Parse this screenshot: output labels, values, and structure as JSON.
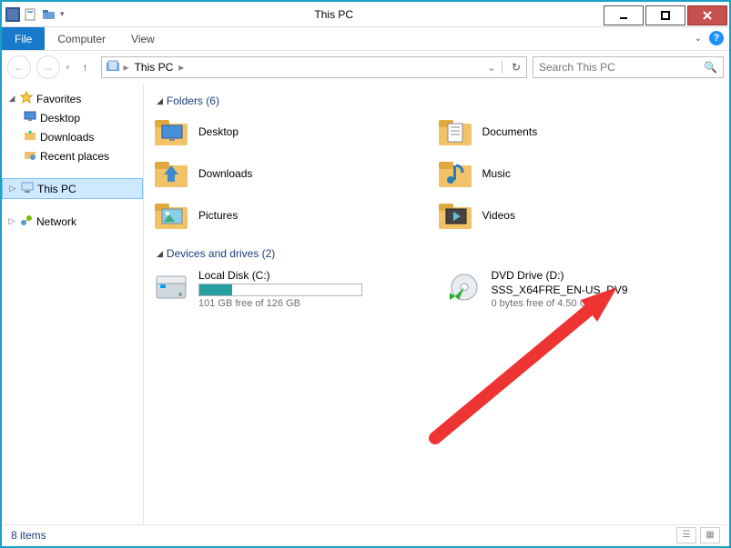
{
  "window": {
    "title": "This PC"
  },
  "ribbon": {
    "file": "File",
    "tabs": [
      "Computer",
      "View"
    ]
  },
  "nav": {
    "breadcrumb": "This PC",
    "refresh_dropdown": "⌄",
    "search_placeholder": "Search This PC"
  },
  "tree": {
    "favorites": {
      "label": "Favorites",
      "items": [
        {
          "label": "Desktop"
        },
        {
          "label": "Downloads"
        },
        {
          "label": "Recent places"
        }
      ]
    },
    "thispc": {
      "label": "This PC"
    },
    "network": {
      "label": "Network"
    }
  },
  "sections": {
    "folders": {
      "label": "Folders (6)"
    },
    "drives": {
      "label": "Devices and drives (2)"
    }
  },
  "folders": [
    {
      "label": "Desktop",
      "overlay": "desktop"
    },
    {
      "label": "Documents",
      "overlay": "docs"
    },
    {
      "label": "Downloads",
      "overlay": "download"
    },
    {
      "label": "Music",
      "overlay": "music"
    },
    {
      "label": "Pictures",
      "overlay": "picture"
    },
    {
      "label": "Videos",
      "overlay": "video"
    }
  ],
  "drives": [
    {
      "name": "Local Disk (C:)",
      "free_text": "101 GB free of 126 GB",
      "used_pct": 20,
      "kind": "hdd"
    },
    {
      "name": "DVD Drive (D:)",
      "sub": "SSS_X64FRE_EN-US_DV9",
      "free_text": "0 bytes free of 4.50 GB",
      "kind": "dvd"
    }
  ],
  "status": {
    "items": "8 items"
  },
  "annotation": {
    "type": "arrow",
    "color": "#e33"
  }
}
